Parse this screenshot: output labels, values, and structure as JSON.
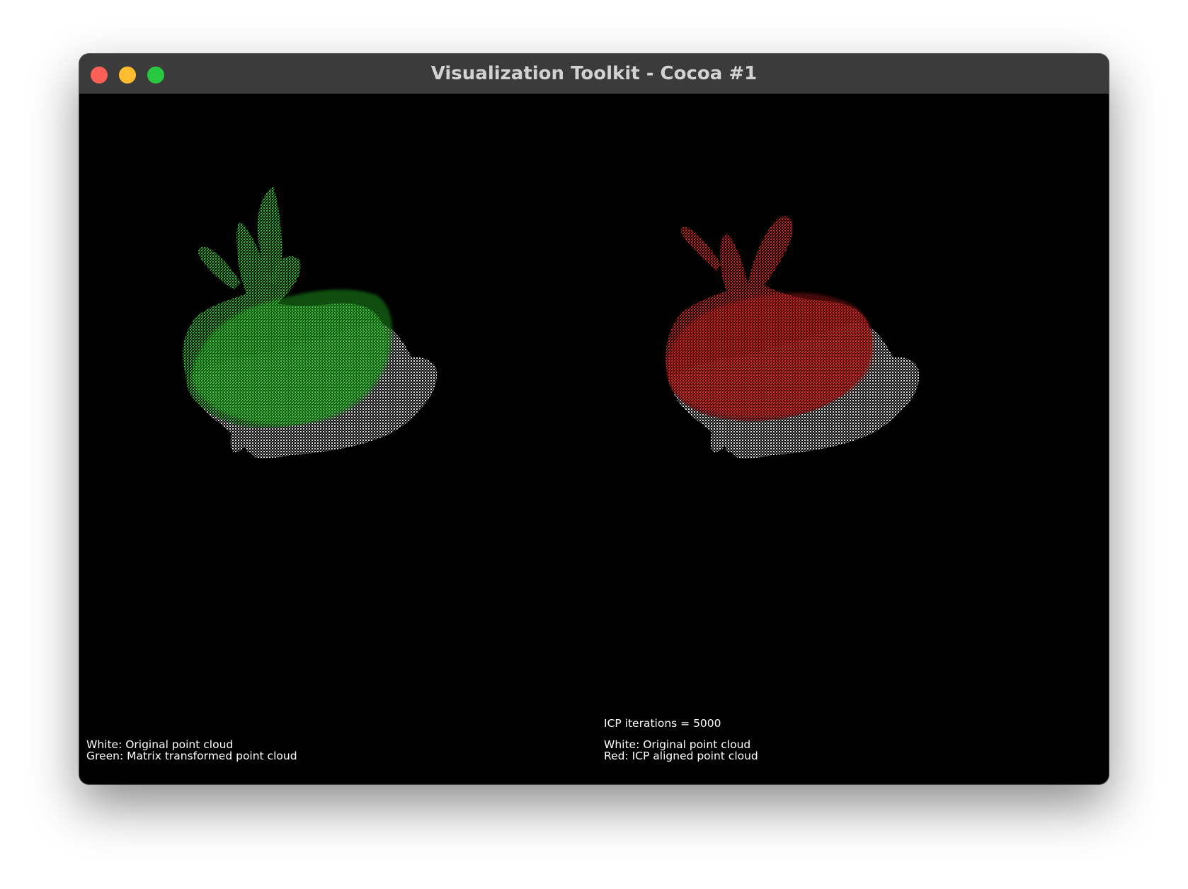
{
  "window": {
    "title": "Visualization Toolkit - Cocoa #1"
  },
  "left_view": {
    "legend_line1": "White: Original point cloud",
    "legend_line2": "Green: Matrix transformed point cloud",
    "transformed_color": "#2fb82f",
    "original_color": "#ffffff"
  },
  "right_view": {
    "iterations": "ICP iterations = 5000",
    "legend_line1": "White: Original point cloud",
    "legend_line2": "Red: ICP aligned point cloud",
    "aligned_color": "#c41f1f",
    "original_color": "#ffffff"
  },
  "colors": {
    "titlebar": "#3b3b3b",
    "background": "#000000",
    "close": "#fe5f57",
    "minimize": "#febc2e",
    "maximize": "#28c840"
  }
}
